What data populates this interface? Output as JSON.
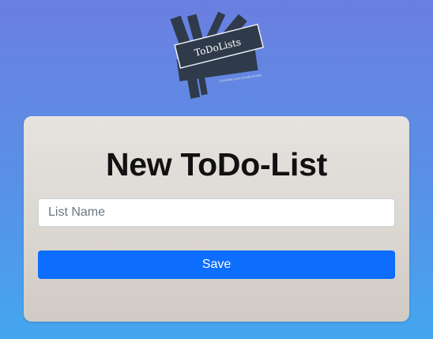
{
  "logo": {
    "icon": "todolists-logo",
    "title": "ToDoLists",
    "tagline": "increase your productivity!"
  },
  "form": {
    "heading": "New ToDo-List",
    "list_name_placeholder": "List Name",
    "list_name_value": "",
    "save_label": "Save"
  },
  "colors": {
    "primary_button": "#0d6efd",
    "logo_dark": "#2f3a4a",
    "bg_top": "#6b7fe0",
    "bg_bottom": "#44a6ee"
  }
}
